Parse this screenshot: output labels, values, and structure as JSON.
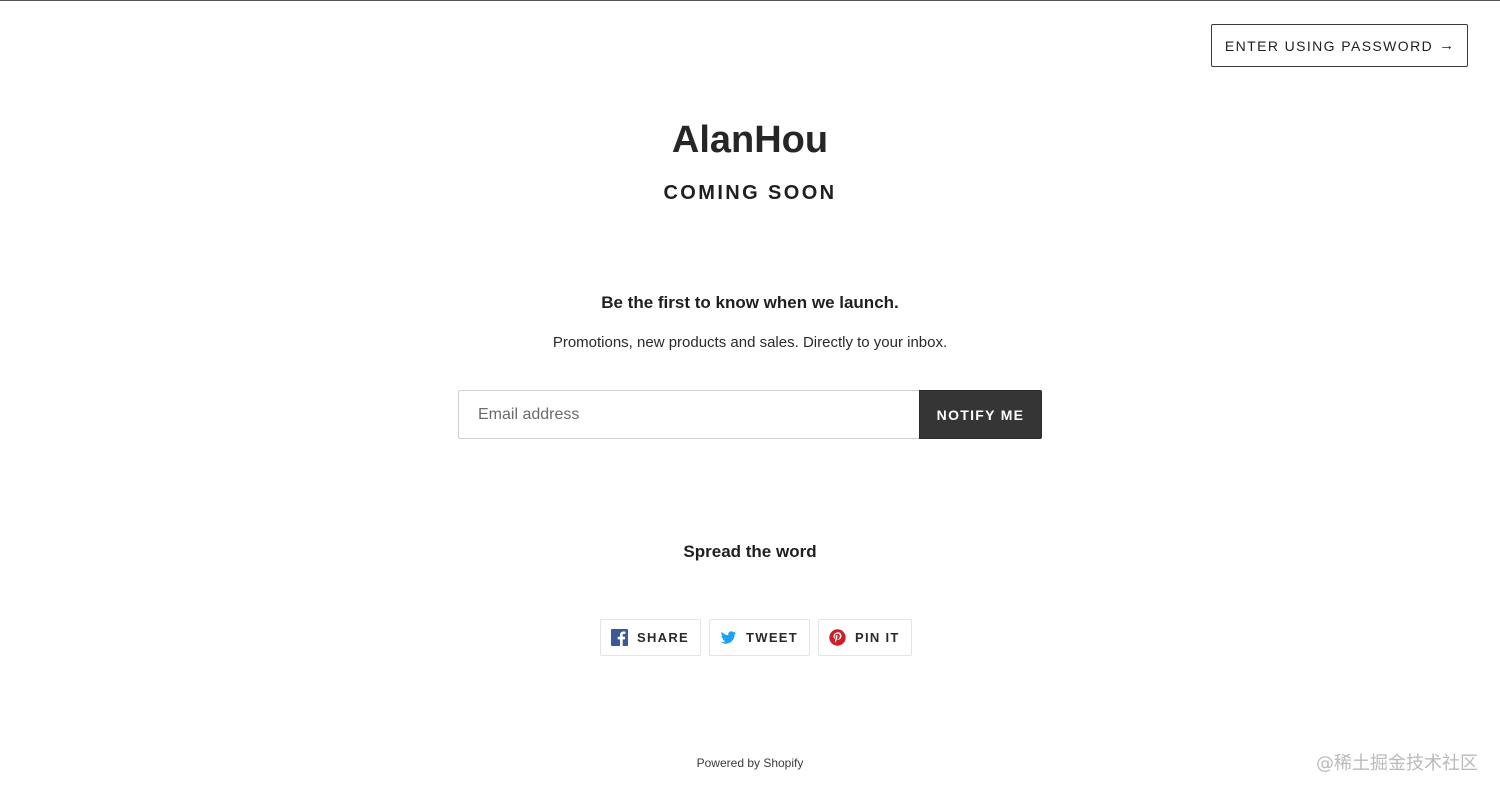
{
  "header": {
    "password_button_label": "ENTER USING PASSWORD",
    "password_button_arrow": "→"
  },
  "hero": {
    "store_name": "AlanHou",
    "status": "COMING SOON"
  },
  "signup": {
    "heading": "Be the first to know when we launch.",
    "text": "Promotions, new products and sales. Directly to your inbox.",
    "email_placeholder": "Email address",
    "email_value": "",
    "notify_label": "NOTIFY ME"
  },
  "share": {
    "heading": "Spread the word",
    "buttons": [
      {
        "label": "SHARE",
        "icon": "facebook-icon",
        "color": "#3b5998"
      },
      {
        "label": "TWEET",
        "icon": "twitter-icon",
        "color": "#00aced"
      },
      {
        "label": "PIN IT",
        "icon": "pinterest-icon",
        "color": "#cb2027"
      }
    ]
  },
  "footer": {
    "powered_by": "Powered by Shopify"
  },
  "watermark": {
    "text": "@稀土掘金技术社区"
  },
  "colors": {
    "background": "#ffffff",
    "button_dark": "#353535",
    "text": "#1f1f1f"
  }
}
